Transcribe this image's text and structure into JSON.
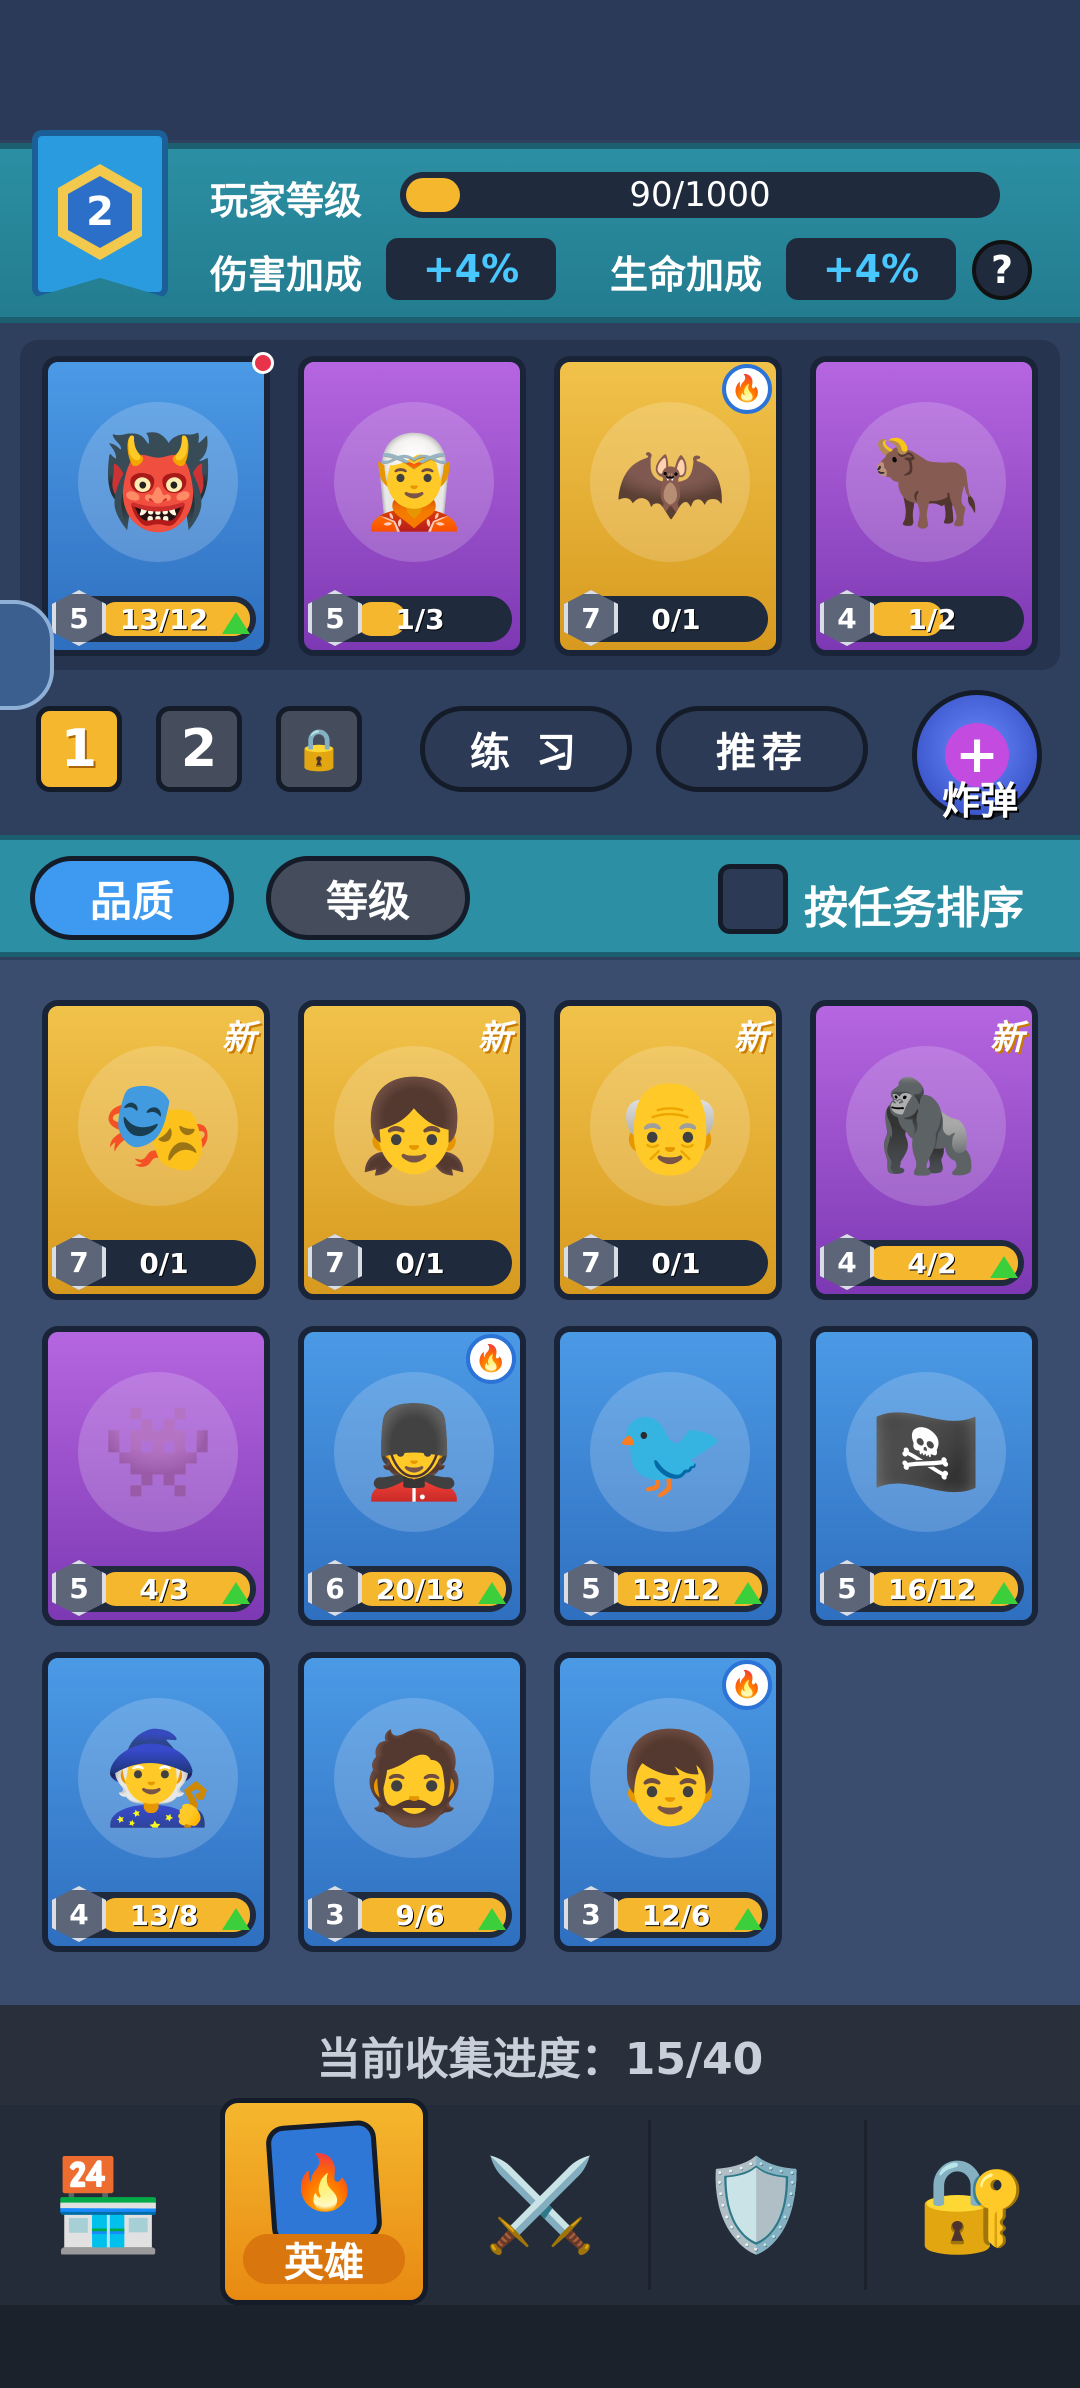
{
  "player": {
    "level": "2",
    "level_label": "玩家等级",
    "xp_text": "90/1000",
    "xp_fraction": 0.09,
    "damage_label": "伤害加成",
    "damage_value": "+4%",
    "health_label": "生命加成",
    "health_value": "+4%",
    "help": "?"
  },
  "team": [
    {
      "level": "5",
      "count": "13/12",
      "color": "blue",
      "upgrade": true,
      "fill": 1.0,
      "icon": "👹",
      "red_dot": true
    },
    {
      "level": "5",
      "count": "1/3",
      "color": "purple",
      "upgrade": false,
      "fill": 0.33,
      "icon": "🧝"
    },
    {
      "level": "7",
      "count": "0/1",
      "color": "gold",
      "upgrade": false,
      "fill": 0.0,
      "icon": "🦇",
      "fire": true
    },
    {
      "level": "4",
      "count": "1/2",
      "color": "purple",
      "upgrade": false,
      "fill": 0.5,
      "icon": "🐂"
    }
  ],
  "presets": {
    "one": "1",
    "two": "2"
  },
  "actions": {
    "practice": "练 习",
    "recommend": "推荐",
    "bomb": "炸弹"
  },
  "filters": {
    "quality": "品质",
    "level": "等级",
    "sort_by_task": "按任务排序"
  },
  "heroes": [
    {
      "level": "7",
      "count": "0/1",
      "color": "gold",
      "new": true,
      "upgrade": false,
      "fill": 0.0,
      "icon": "🎭"
    },
    {
      "level": "7",
      "count": "0/1",
      "color": "gold",
      "new": true,
      "upgrade": false,
      "fill": 0.0,
      "icon": "👧"
    },
    {
      "level": "7",
      "count": "0/1",
      "color": "gold",
      "new": true,
      "upgrade": false,
      "fill": 0.0,
      "icon": "👴"
    },
    {
      "level": "4",
      "count": "4/2",
      "color": "purple",
      "new": true,
      "upgrade": true,
      "fill": 1.0,
      "icon": "🦍"
    },
    {
      "level": "5",
      "count": "4/3",
      "color": "purple",
      "new": false,
      "upgrade": true,
      "fill": 1.0,
      "icon": "👾"
    },
    {
      "level": "6",
      "count": "20/18",
      "color": "blue",
      "new": false,
      "upgrade": true,
      "fill": 1.0,
      "icon": "💂",
      "fire": true
    },
    {
      "level": "5",
      "count": "13/12",
      "color": "blue",
      "new": false,
      "upgrade": true,
      "fill": 1.0,
      "icon": "🐦"
    },
    {
      "level": "5",
      "count": "16/12",
      "color": "blue",
      "new": false,
      "upgrade": true,
      "fill": 1.0,
      "icon": "🏴‍☠️"
    },
    {
      "level": "4",
      "count": "13/8",
      "color": "blue",
      "new": false,
      "upgrade": true,
      "fill": 1.0,
      "icon": "🧙"
    },
    {
      "level": "3",
      "count": "9/6",
      "color": "blue",
      "new": false,
      "upgrade": true,
      "fill": 1.0,
      "icon": "🧔"
    },
    {
      "level": "3",
      "count": "12/6",
      "color": "blue",
      "new": false,
      "upgrade": true,
      "fill": 1.0,
      "icon": "👦",
      "fire": true
    }
  ],
  "new_tag": "新",
  "collection": {
    "text": "当前收集进度：15/40"
  },
  "nav": {
    "shop_icon": "shop-icon",
    "hero_label": "英雄",
    "battle_icon": "crossed-swords-icon",
    "clan_icon": "shield-icon",
    "locked_icon": "lock-icon"
  },
  "colors": {
    "gold": "#f5b72e",
    "accent_blue": "#49c8ff",
    "panel_teal": "#2c8fa3"
  }
}
